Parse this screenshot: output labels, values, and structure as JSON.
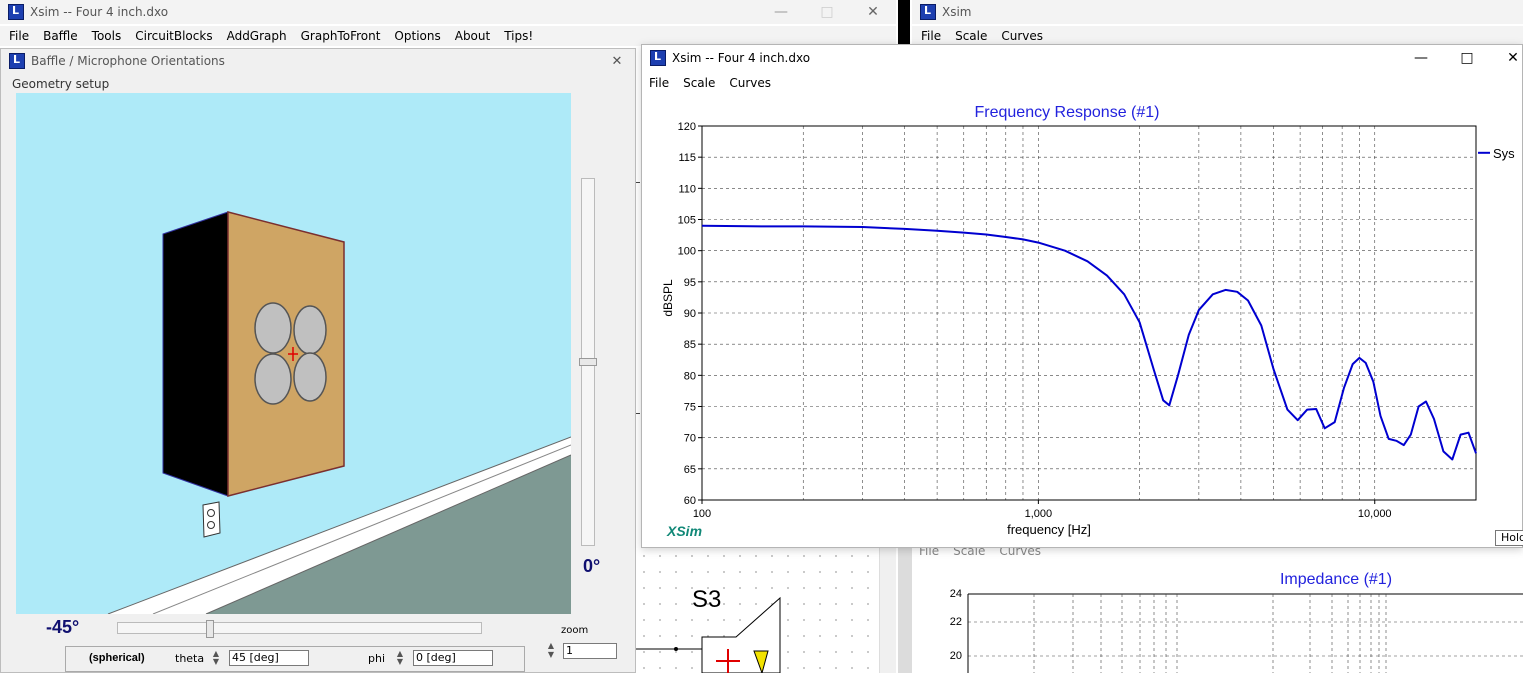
{
  "main_window": {
    "title": "Xsim -- Four 4 inch.dxo",
    "menu": [
      "File",
      "Baffle",
      "Tools",
      "CircuitBlocks",
      "AddGraph",
      "GraphToFront",
      "Options",
      "About",
      "Tips!"
    ]
  },
  "right_window": {
    "title": "Xsim",
    "menu": [
      "File",
      "Scale",
      "Curves"
    ]
  },
  "baffle_dialog": {
    "title": "Baffle / Microphone Orientations",
    "menu_label": "Geometry setup",
    "vertical_angle": "0°",
    "horizontal_angle": "-45°",
    "horizontal_slider_value": 0.25,
    "vertical_slider_value": 0.5,
    "zoom_label": "zoom",
    "zoom_value": "1",
    "mode_label": "(spherical)",
    "theta_label": "theta",
    "theta_value": "45 [deg]",
    "phi_label": "phi",
    "phi_value": "0 [deg]"
  },
  "graph_window": {
    "title": "Xsim -- Four 4 inch.dxo",
    "menu": [
      "File",
      "Scale",
      "Curves"
    ],
    "watermark": "XSim",
    "hold_button": "Hold"
  },
  "background": {
    "menu": [
      "File",
      "Scale",
      "Curves"
    ],
    "schematic_label": "S3",
    "impedance_title": "Impedance (#1)",
    "impedance_ticks": [
      "24",
      "22",
      "20"
    ]
  },
  "colors": {
    "sky": "#aeeaf8",
    "floor": "#7e9993",
    "baffle_face": "#cfa564",
    "cabinet_side": "#000000",
    "driver": "#c0c0c0",
    "curve": "#0000d0",
    "title_blue": "#2222dd",
    "angle_text": "#101070",
    "watermark": "#118877"
  },
  "chart_data": {
    "type": "line",
    "title": "Frequency Response (#1)",
    "xlabel": "frequency [Hz]",
    "ylabel": "dBSPL",
    "x_scale": "log",
    "xlim": [
      100,
      20000
    ],
    "ylim": [
      60,
      120
    ],
    "x_tick_labels": [
      "100",
      "1,000",
      "10,000"
    ],
    "y_ticks": [
      60,
      65,
      70,
      75,
      80,
      85,
      90,
      95,
      100,
      105,
      110,
      115,
      120
    ],
    "grid": true,
    "legend_position": "right",
    "series": [
      {
        "name": "Sys",
        "x": [
          100,
          150,
          200,
          300,
          400,
          500,
          600,
          700,
          800,
          900,
          1000,
          1200,
          1400,
          1600,
          1800,
          2000,
          2200,
          2350,
          2450,
          2600,
          2800,
          3000,
          3300,
          3600,
          3900,
          4200,
          4600,
          5000,
          5500,
          5900,
          6300,
          6700,
          7100,
          7600,
          8100,
          8600,
          9000,
          9400,
          9900,
          10400,
          11000,
          11600,
          12200,
          12800,
          13500,
          14200,
          15000,
          16000,
          17000,
          18000,
          19000,
          20000
        ],
        "y": [
          104,
          103.9,
          103.9,
          103.8,
          103.5,
          103.2,
          102.9,
          102.6,
          102.2,
          101.8,
          101.3,
          100,
          98.3,
          96,
          93,
          88.5,
          81,
          76,
          75.2,
          80,
          86.5,
          90.5,
          93,
          93.7,
          93.4,
          92,
          88,
          81,
          74.5,
          72.8,
          74.5,
          74.6,
          71.5,
          72.5,
          78,
          81.8,
          82.8,
          82,
          79,
          73.5,
          69.8,
          69.5,
          68.8,
          70.5,
          75,
          75.8,
          73,
          67.8,
          66.5,
          70.5,
          70.8,
          67.5
        ]
      }
    ]
  }
}
